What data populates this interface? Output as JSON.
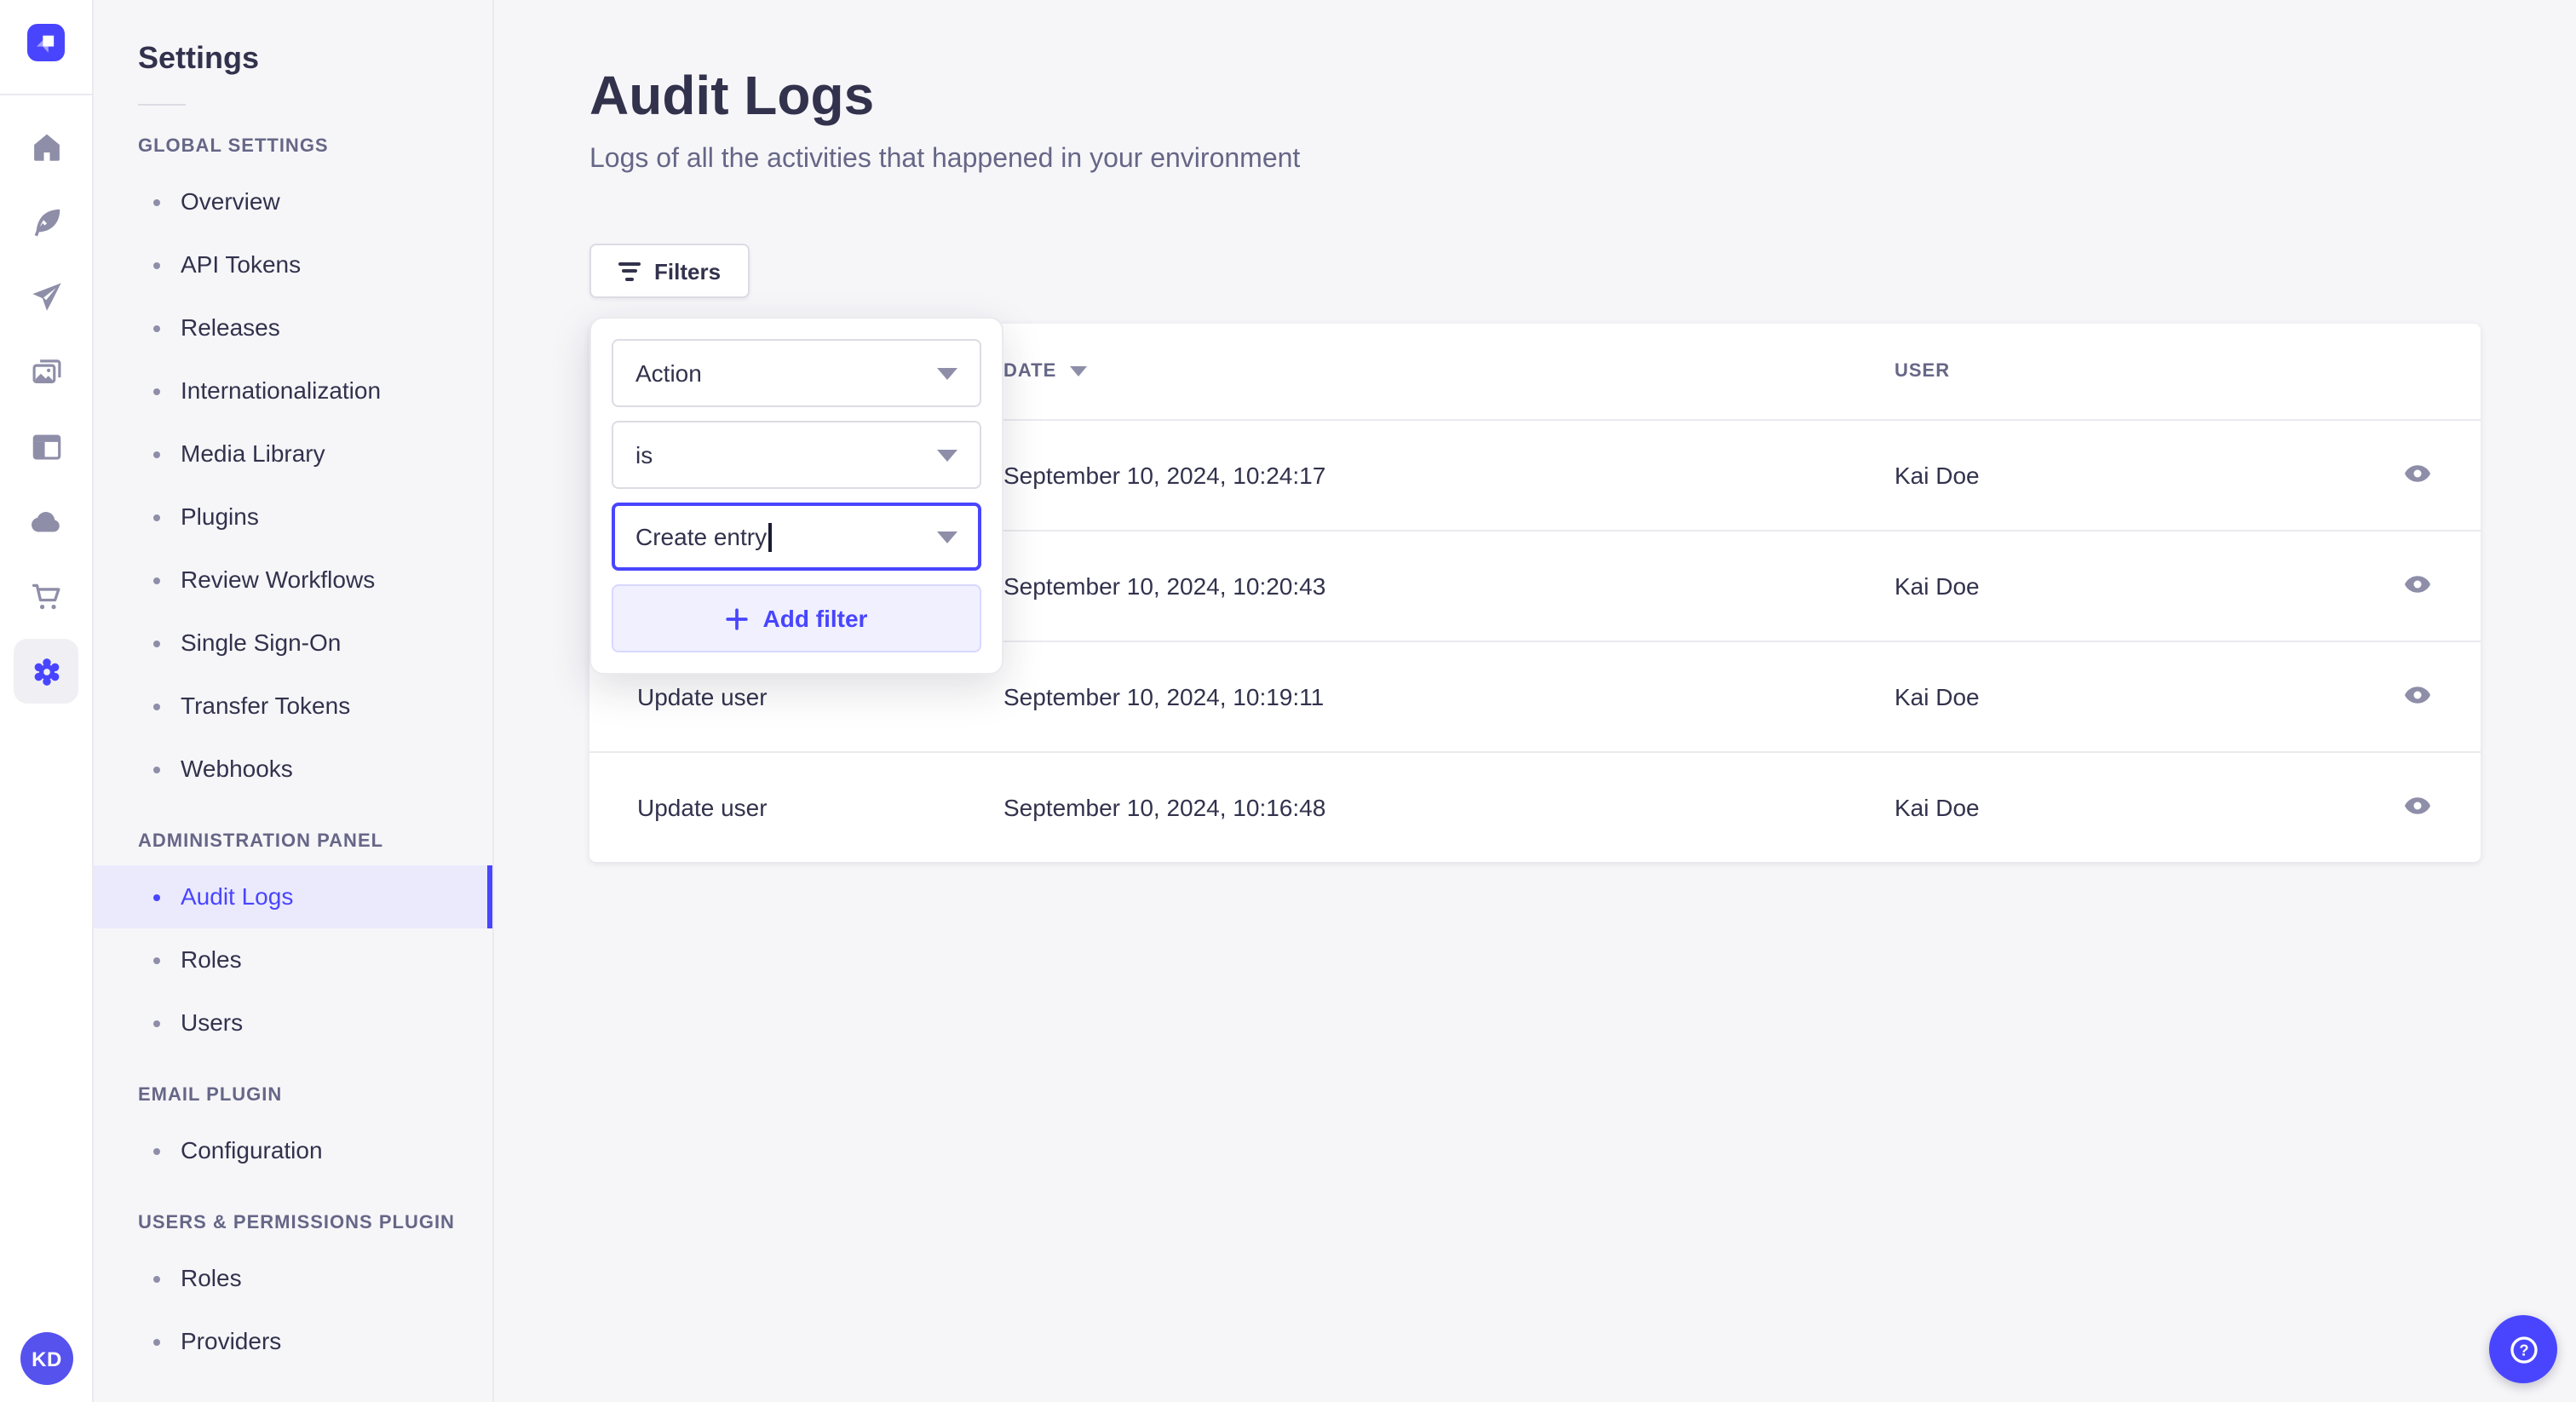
{
  "user": {
    "initials": "KD"
  },
  "sidebar": {
    "title": "Settings",
    "sections": [
      {
        "label": "GLOBAL SETTINGS",
        "items": [
          {
            "label": "Overview"
          },
          {
            "label": "API Tokens"
          },
          {
            "label": "Releases"
          },
          {
            "label": "Internationalization"
          },
          {
            "label": "Media Library"
          },
          {
            "label": "Plugins"
          },
          {
            "label": "Review Workflows"
          },
          {
            "label": "Single Sign-On"
          },
          {
            "label": "Transfer Tokens"
          },
          {
            "label": "Webhooks"
          }
        ]
      },
      {
        "label": "ADMINISTRATION PANEL",
        "items": [
          {
            "label": "Audit Logs",
            "active": true
          },
          {
            "label": "Roles"
          },
          {
            "label": "Users"
          }
        ]
      },
      {
        "label": "EMAIL PLUGIN",
        "items": [
          {
            "label": "Configuration"
          }
        ]
      },
      {
        "label": "USERS & PERMISSIONS PLUGIN",
        "items": [
          {
            "label": "Roles"
          },
          {
            "label": "Providers"
          }
        ]
      }
    ]
  },
  "icon_rail": {
    "icons": [
      "strapi-logo",
      "home-icon",
      "feather-pen-icon",
      "paper-plane-icon",
      "media-library-icon",
      "content-type-builder-icon",
      "cloud-icon",
      "marketplace-cart-icon",
      "settings-gear-icon"
    ],
    "active_icon": "settings-gear-icon"
  },
  "header": {
    "title": "Audit Logs",
    "subtitle": "Logs of all the activities that happened in your environment"
  },
  "toolbar": {
    "filters_label": "Filters"
  },
  "filter_popover": {
    "field_value": "Action",
    "operator_value": "is",
    "value_text": "Create entry",
    "add_filter_label": "Add filter"
  },
  "table": {
    "headers": {
      "date": "DATE",
      "user": "USER"
    },
    "sort": {
      "column": "date",
      "direction": "desc"
    },
    "rows": [
      {
        "action": "",
        "date": "September 10, 2024, 10:24:17",
        "user": "Kai Doe"
      },
      {
        "action": "",
        "date": "September 10, 2024, 10:20:43",
        "user": "Kai Doe"
      },
      {
        "action": "Update user",
        "date": "September 10, 2024, 10:19:11",
        "user": "Kai Doe"
      },
      {
        "action": "Update user",
        "date": "September 10, 2024, 10:16:48",
        "user": "Kai Doe"
      }
    ]
  },
  "colors": {
    "primary": "#4945FF",
    "primary_light": "#F0F0FF",
    "primary_border": "#D9D8FF",
    "active_item_bg": "#EBEAFC",
    "text": "#32324D",
    "text_muted": "#666687",
    "icon_gray": "#8E8EA9",
    "page_bg": "#F6F6F9",
    "border": "#EAEAEF",
    "input_border": "#DCDCE4"
  }
}
